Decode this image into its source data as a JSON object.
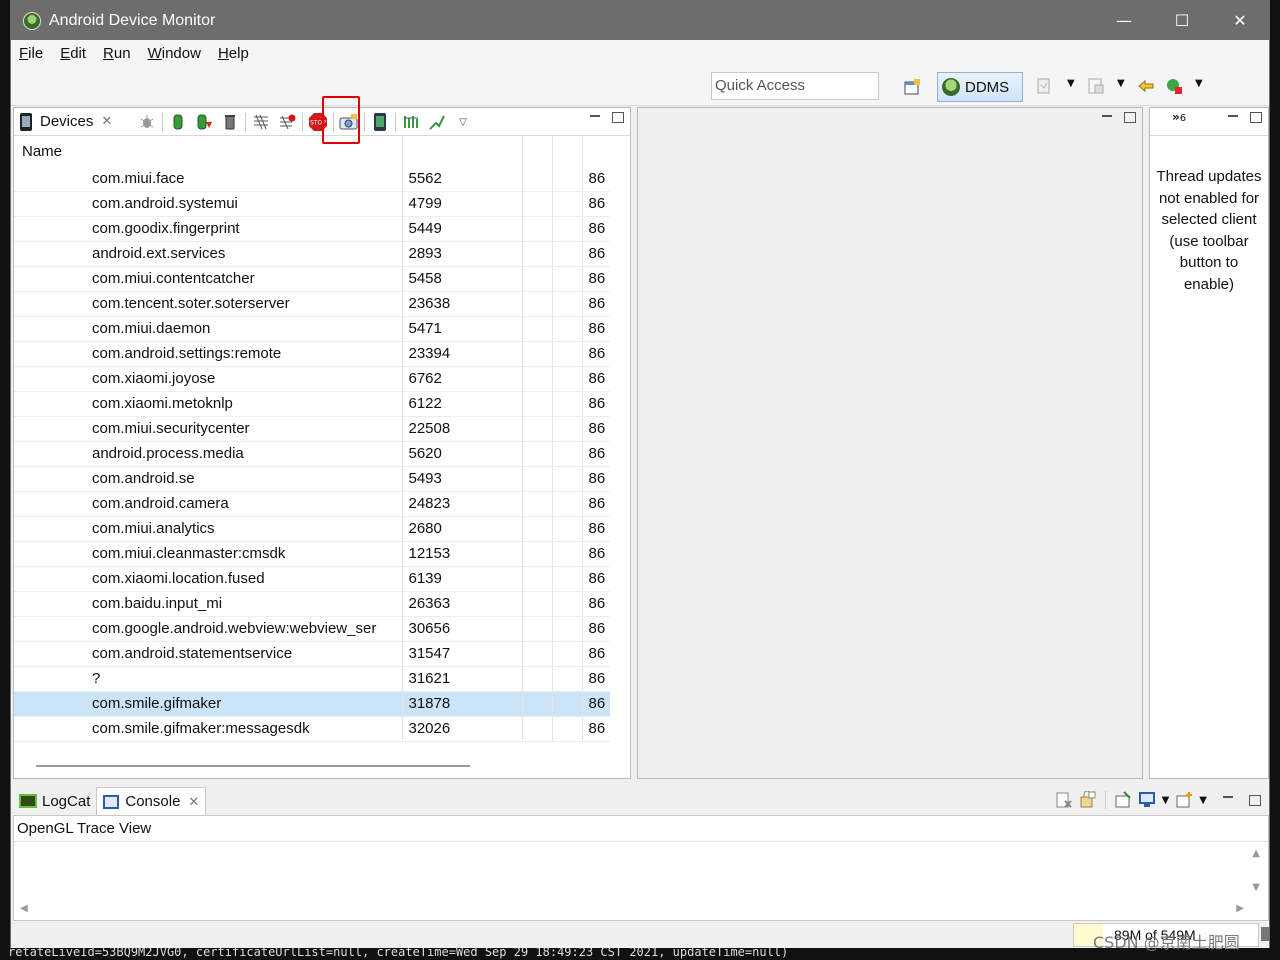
{
  "window": {
    "title": "Android Device Monitor",
    "controls": [
      "—",
      "☐",
      "✕"
    ]
  },
  "menu": {
    "items": [
      {
        "underline": "F",
        "rest": "ile"
      },
      {
        "underline": "E",
        "rest": "dit"
      },
      {
        "underline": "R",
        "rest": "un"
      },
      {
        "underline": "W",
        "rest": "indow"
      },
      {
        "underline": "H",
        "rest": "elp"
      }
    ]
  },
  "toolbar": {
    "quick_access_placeholder": "Quick Access",
    "perspective_label": "DDMS"
  },
  "devices": {
    "tab_label": "Devices",
    "column_header": "Name",
    "rows": [
      {
        "name": "com.miui.face",
        "pid": "5562",
        "port": "86"
      },
      {
        "name": "com.android.systemui",
        "pid": "4799",
        "port": "86"
      },
      {
        "name": "com.goodix.fingerprint",
        "pid": "5449",
        "port": "86"
      },
      {
        "name": "android.ext.services",
        "pid": "2893",
        "port": "86"
      },
      {
        "name": "com.miui.contentcatcher",
        "pid": "5458",
        "port": "86"
      },
      {
        "name": "com.tencent.soter.soterserver",
        "pid": "23638",
        "port": "86"
      },
      {
        "name": "com.miui.daemon",
        "pid": "5471",
        "port": "86"
      },
      {
        "name": "com.android.settings:remote",
        "pid": "23394",
        "port": "86"
      },
      {
        "name": "com.xiaomi.joyose",
        "pid": "6762",
        "port": "86"
      },
      {
        "name": "com.xiaomi.metoknlp",
        "pid": "6122",
        "port": "86"
      },
      {
        "name": "com.miui.securitycenter",
        "pid": "22508",
        "port": "86"
      },
      {
        "name": "android.process.media",
        "pid": "5620",
        "port": "86"
      },
      {
        "name": "com.android.se",
        "pid": "5493",
        "port": "86"
      },
      {
        "name": "com.android.camera",
        "pid": "24823",
        "port": "86"
      },
      {
        "name": "com.miui.analytics",
        "pid": "2680",
        "port": "86"
      },
      {
        "name": "com.miui.cleanmaster:cmsdk",
        "pid": "12153",
        "port": "86"
      },
      {
        "name": "com.xiaomi.location.fused",
        "pid": "6139",
        "port": "86"
      },
      {
        "name": "com.baidu.input_mi",
        "pid": "26363",
        "port": "86"
      },
      {
        "name": "com.google.android.webview:webview_ser",
        "pid": "30656",
        "port": "86"
      },
      {
        "name": "com.android.statementservice",
        "pid": "31547",
        "port": "86"
      },
      {
        "name": "?",
        "pid": "31621",
        "port": "86"
      },
      {
        "name": "com.smile.gifmaker",
        "pid": "31878",
        "port": "86",
        "selected": true
      },
      {
        "name": "com.smile.gifmaker:messagesdk",
        "pid": "32026",
        "port": "86"
      }
    ]
  },
  "threads_panel": {
    "message": "Thread updates not enabled for selected client (use toolbar button to enable)",
    "overflow_count": "6"
  },
  "bottom": {
    "tabs": [
      {
        "label": "LogCat"
      },
      {
        "label": "Console"
      }
    ],
    "console_title": "OpenGL Trace View"
  },
  "status": {
    "heap": "89M of 549M",
    "heap_fraction": 0.16
  },
  "background_terminal": {
    "bottom_line": "retateLiveId=53BQ9M2JVG0, certificateUrlList=null, createTime=Wed Sep 29 18:49:23 CST 2021, updateTime=null)"
  },
  "watermark": "CSDN @京南土肥圆",
  "colors": {
    "titlebar": "#6d6d6d",
    "selection": "#cce4f7",
    "highlight_box": "#e00000"
  }
}
